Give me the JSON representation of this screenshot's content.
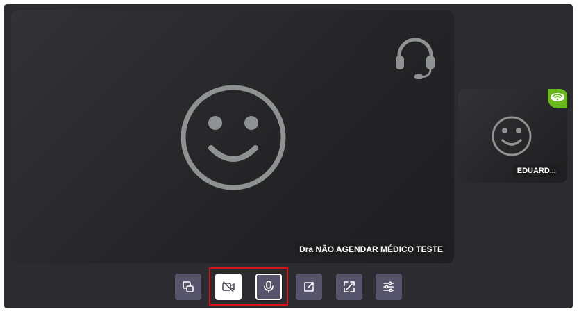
{
  "main_participant": {
    "name": "Dra NÃO AGENDAR MÉDICO TESTE",
    "avatar_icon": "smiley-face-icon",
    "badge_icon": "headset-icon"
  },
  "side_participant": {
    "name": "EDUARD...",
    "avatar_icon": "smiley-face-icon",
    "signal_icon": "wifi-icon",
    "signal_color": "#69b81c"
  },
  "toolbar": {
    "buttons": [
      {
        "id": "picture-in-picture",
        "icon": "picture-in-picture-icon"
      },
      {
        "id": "camera",
        "icon": "video-off-icon",
        "state": "off"
      },
      {
        "id": "microphone",
        "icon": "microphone-icon",
        "state": "on"
      },
      {
        "id": "share-screen",
        "icon": "share-screen-icon"
      },
      {
        "id": "fullscreen",
        "icon": "fullscreen-icon"
      },
      {
        "id": "settings",
        "icon": "sliders-icon"
      }
    ],
    "highlight_color": "#d8141c"
  }
}
